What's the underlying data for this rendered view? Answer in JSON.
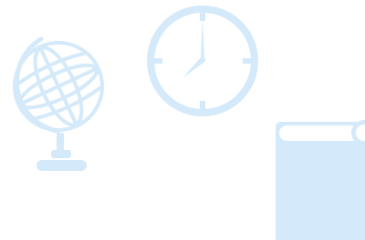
{
  "colors": {
    "background": "#ffffff",
    "illustration": "#d4e9f9"
  },
  "icons": {
    "globe": "globe-icon",
    "clock": "clock-icon",
    "book": "book-icon"
  },
  "clock": {
    "time_shown": "7:00"
  }
}
